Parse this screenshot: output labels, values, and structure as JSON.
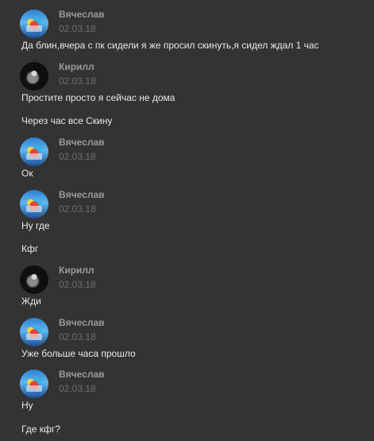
{
  "messages": [
    {
      "author": "Вячеслав",
      "avatar": "user-avatar-vyacheslav",
      "date": "02.03.18",
      "lines": [
        "Да блин,вчера с пк сидели я же просил скинуть,я сидел ждал 1 час"
      ]
    },
    {
      "author": "Кирилл",
      "avatar": "user-avatar-kirill",
      "date": "02.03.18",
      "lines": [
        "Простите просто я сейчас не дома",
        "Через час все Скину"
      ]
    },
    {
      "author": "Вячеслав",
      "avatar": "user-avatar-vyacheslav",
      "date": "02.03.18",
      "lines": [
        "Ок"
      ]
    },
    {
      "author": "Вячеслав",
      "avatar": "user-avatar-vyacheslav",
      "date": "02.03.18",
      "lines": [
        "Ну где",
        "Кфг"
      ]
    },
    {
      "author": "Кирилл",
      "avatar": "user-avatar-kirill",
      "date": "02.03.18",
      "lines": [
        "Жди"
      ]
    },
    {
      "author": "Вячеслав",
      "avatar": "user-avatar-vyacheslav",
      "date": "02.03.18",
      "lines": [
        "Уже больше часа прошло"
      ]
    },
    {
      "author": "Вячеслав",
      "avatar": "user-avatar-vyacheslav",
      "date": "02.03.18",
      "lines": [
        "Ну",
        "Где кфг?"
      ]
    }
  ]
}
